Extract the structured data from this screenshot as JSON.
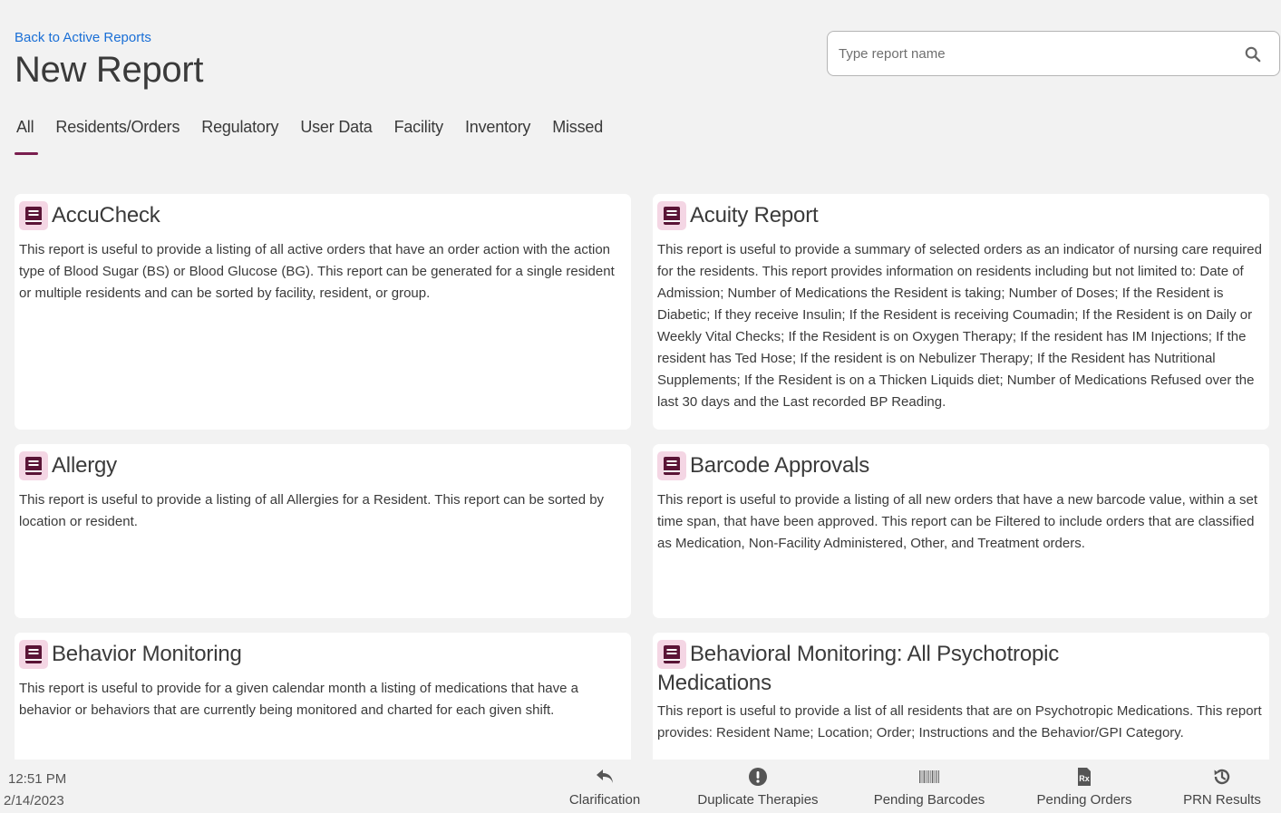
{
  "header": {
    "back_link": "Back to Active Reports",
    "title": "New Report",
    "search_placeholder": "Type report name"
  },
  "tabs": [
    {
      "label": "All",
      "active": true
    },
    {
      "label": "Residents/Orders"
    },
    {
      "label": "Regulatory"
    },
    {
      "label": "User Data"
    },
    {
      "label": "Facility"
    },
    {
      "label": "Inventory"
    },
    {
      "label": "Missed"
    }
  ],
  "reports": [
    {
      "title": "AccuCheck",
      "description": "This report is useful to provide a listing of all active orders that have an order action with the action type of Blood Sugar (BS) or Blood Glucose (BG). This report can be generated for a single resident or multiple residents and can be sorted by facility, resident, or group."
    },
    {
      "title": "Acuity Report",
      "description": "This report is useful to provide a summary of selected orders as an indicator of nursing care required for the residents. This report provides information on residents including but not limited to: Date of Admission; Number of Medications the Resident is taking; Number of Doses; If the Resident is Diabetic; If they receive Insulin; If the Resident is receiving Coumadin; If the Resident is on Daily or Weekly Vital Checks; If the Resident is on Oxygen Therapy; If the resident has IM Injections; If the resident has Ted Hose; If the resident is on Nebulizer Therapy; If the Resident has Nutritional Supplements; If the Resident is on a Thicken Liquids diet; Number of Medications Refused over the last 30 days and the Last recorded BP Reading."
    },
    {
      "title": "Allergy",
      "description": "This report is useful to provide a listing of all Allergies for a Resident. This report can be sorted by location or resident."
    },
    {
      "title": "Barcode Approvals",
      "description": "This report is useful to provide a listing of all new orders that have a new barcode value, within a set time span, that have been approved. This report can be Filtered to include orders that are classified as Medication, Non-Facility Administered, Other, and Treatment orders."
    },
    {
      "title": "Behavior Monitoring",
      "description": "This report is useful to provide for a given calendar month a listing of medications that have a behavior or behaviors that are currently being monitored and charted for each given shift."
    },
    {
      "title": "Behavioral Monitoring: All Psychotropic Medications",
      "description": "This report is useful to provide a list of all residents that are on Psychotropic Medications. This report provides: Resident Name; Location; Order; Instructions and the Behavior/GPI Category."
    }
  ],
  "footer": {
    "time": "12:51 PM",
    "date": "2/14/2023",
    "buttons": [
      {
        "label": "Clarification",
        "icon": "reply-arrow-icon"
      },
      {
        "label": "Duplicate Therapies",
        "icon": "alert-circle-icon"
      },
      {
        "label": "Pending Barcodes",
        "icon": "barcode-icon"
      },
      {
        "label": "Pending Orders",
        "icon": "prescription-doc-icon"
      },
      {
        "label": "PRN Results",
        "icon": "history-icon"
      }
    ]
  },
  "colors": {
    "accent": "#7a1f4f",
    "link": "#1a6fd6",
    "icon_bg": "#f4d6e4",
    "background": "#f2f2f2",
    "card": "#ffffff"
  }
}
